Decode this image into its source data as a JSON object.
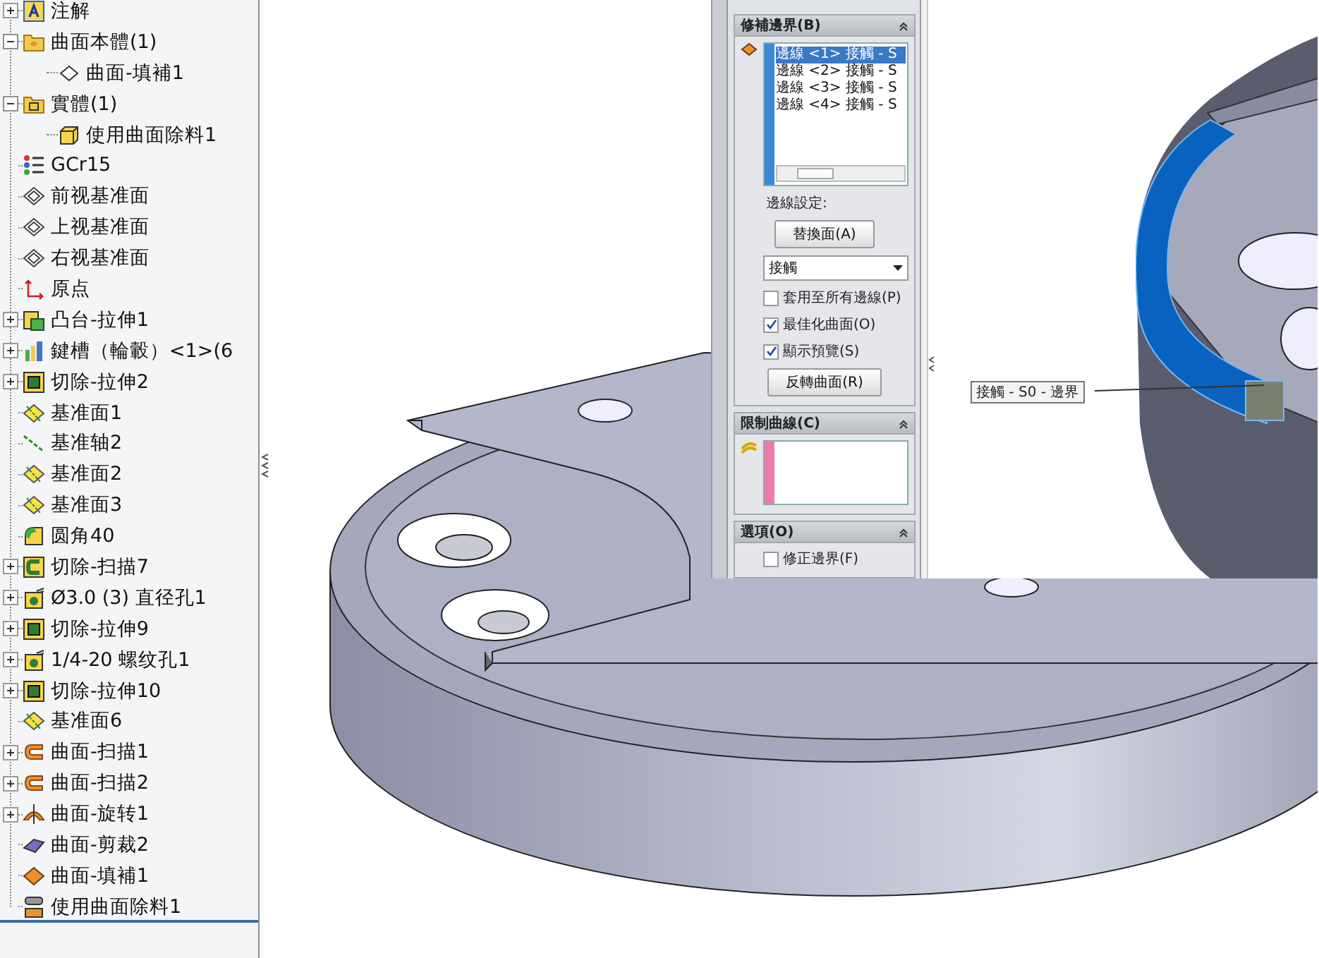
{
  "feature_tree": {
    "items": [
      {
        "label": "注解",
        "kind": "annotation",
        "expanded": false
      },
      {
        "label": "曲面本體(1)",
        "kind": "surfacefolder",
        "expanded": true,
        "children": [
          {
            "label": "曲面-填補1",
            "kind": "surfacebody"
          }
        ]
      },
      {
        "label": "實體(1)",
        "kind": "solidfolder",
        "expanded": true,
        "children": [
          {
            "label": "使用曲面除料1",
            "kind": "solidbody"
          }
        ]
      },
      {
        "label": "GCr15",
        "kind": "material"
      },
      {
        "label": "前视基准面",
        "kind": "plane"
      },
      {
        "label": "上视基准面",
        "kind": "plane"
      },
      {
        "label": "右视基准面",
        "kind": "plane"
      },
      {
        "label": "原点",
        "kind": "origin"
      },
      {
        "label": "凸台-拉伸1",
        "kind": "boss",
        "expanded": false
      },
      {
        "label": "鍵槽（輪轂）<1>(6",
        "kind": "library",
        "expanded": false
      },
      {
        "label": "切除-拉伸2",
        "kind": "cut",
        "expanded": false
      },
      {
        "label": "基准面1",
        "kind": "refplane"
      },
      {
        "label": "基准轴2",
        "kind": "axis"
      },
      {
        "label": "基准面2",
        "kind": "refplane"
      },
      {
        "label": "基准面3",
        "kind": "refplane"
      },
      {
        "label": "圆角40",
        "kind": "fillet"
      },
      {
        "label": "切除-扫描7",
        "kind": "cutsweep",
        "expanded": false
      },
      {
        "label": "Ø3.0 (3) 直径孔1",
        "kind": "hole",
        "expanded": false
      },
      {
        "label": "切除-拉伸9",
        "kind": "cut",
        "expanded": false
      },
      {
        "label": "1/4-20 螺纹孔1",
        "kind": "hole",
        "expanded": false
      },
      {
        "label": "切除-拉伸10",
        "kind": "cut",
        "expanded": false
      },
      {
        "label": "基准面6",
        "kind": "refplane"
      },
      {
        "label": "曲面-扫描1",
        "kind": "sweep",
        "expanded": false
      },
      {
        "label": "曲面-扫描2",
        "kind": "sweep",
        "expanded": false
      },
      {
        "label": "曲面-旋转1",
        "kind": "revolve",
        "expanded": false
      },
      {
        "label": "曲面-剪裁2",
        "kind": "trim"
      },
      {
        "label": "曲面-填補1",
        "kind": "fill"
      },
      {
        "label": "使用曲面除料1",
        "kind": "surfacecut"
      }
    ]
  },
  "property_manager": {
    "boundary": {
      "title": "修補邊界(B)",
      "edges": [
        {
          "label": "邊線 <1> 接觸 - S",
          "selected": true
        },
        {
          "label": "邊線 <2> 接觸 - S",
          "selected": false
        },
        {
          "label": "邊線 <3> 接觸 - S",
          "selected": false
        },
        {
          "label": "邊線 <4> 接觸 - S",
          "selected": false
        }
      ],
      "settings_label": "邊線設定:",
      "replace_button": "替換面(A)",
      "contact_dropdown": "接觸",
      "checkboxes": [
        {
          "label": "套用至所有邊線(P)",
          "checked": false
        },
        {
          "label": "最佳化曲面(O)",
          "checked": true
        },
        {
          "label": "顯示預覽(S)",
          "checked": true
        }
      ],
      "reverse_button": "反轉曲面(R)"
    },
    "constraint_curves": {
      "title": "限制曲線(C)"
    },
    "options": {
      "title": "選項(O)",
      "checkboxes": [
        {
          "label": "修正邊界(F)",
          "checked": false
        }
      ]
    }
  },
  "viewport": {
    "callout": "接觸 - S0 - 邊界"
  }
}
